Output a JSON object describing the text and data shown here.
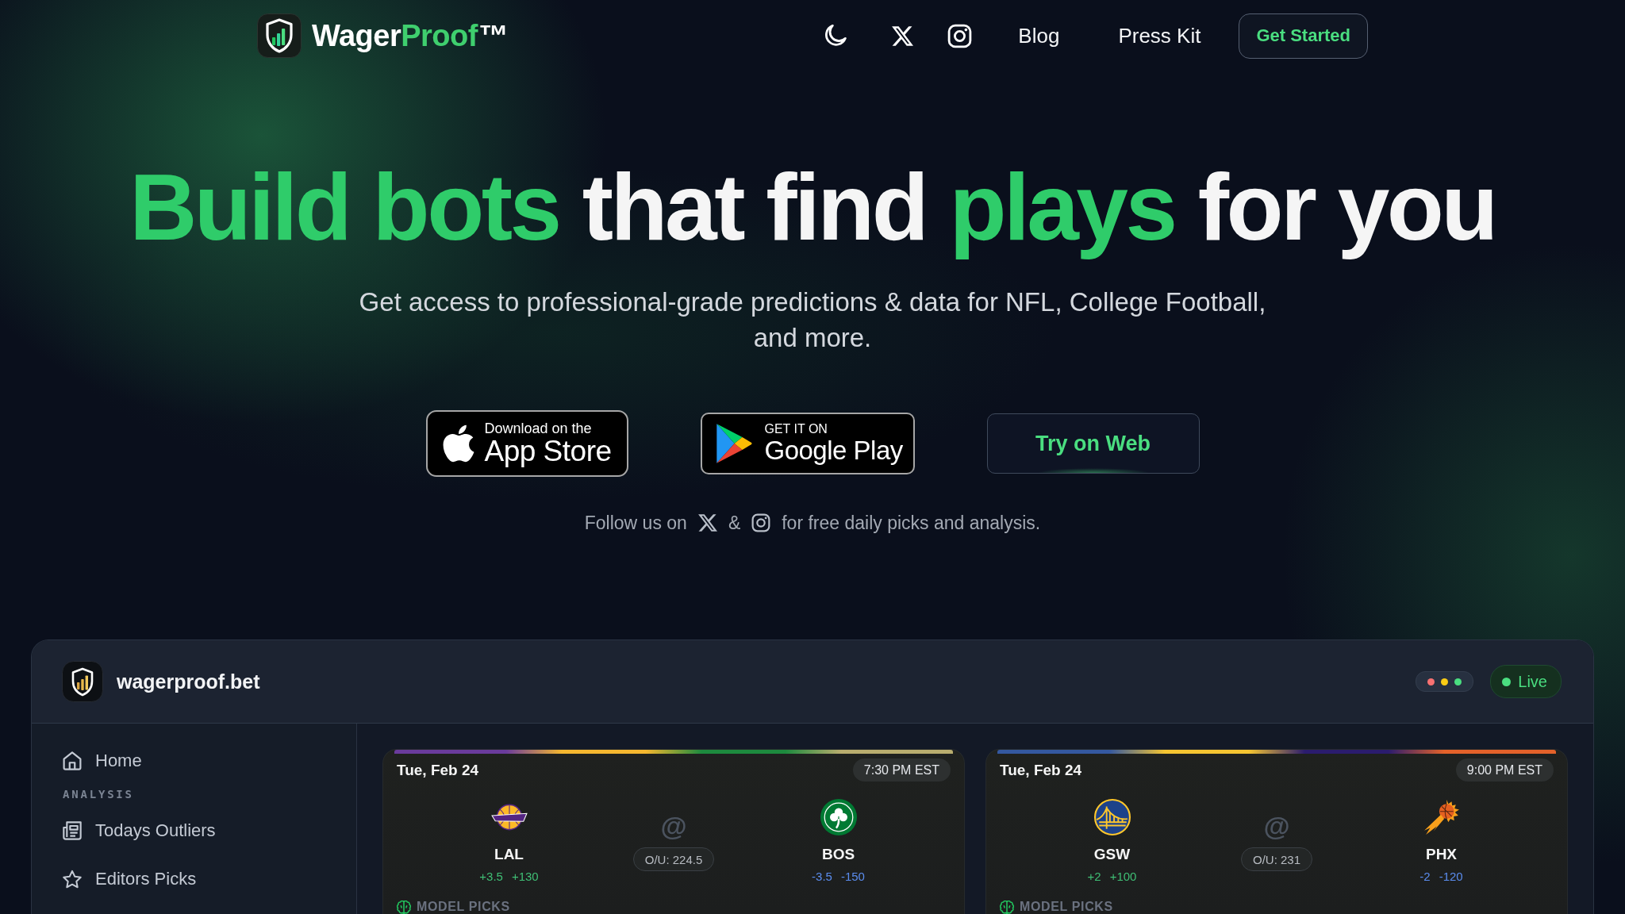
{
  "nav": {
    "logo": {
      "parts": [
        {
          "text": "Wager",
          "accent": false
        },
        {
          "text": "Proof",
          "accent": true
        }
      ],
      "mark": "™"
    },
    "links": [
      {
        "label": "Blog"
      },
      {
        "label": "Press Kit"
      }
    ],
    "cta": "Get Started"
  },
  "hero": {
    "headline": [
      {
        "text": "Build bots ",
        "accent": true
      },
      {
        "text": "that find ",
        "accent": false
      },
      {
        "text": "plays ",
        "accent": true
      },
      {
        "text": "for you",
        "accent": false
      }
    ],
    "subtitle": "Get access to professional-grade predictions & data for NFL, College Football, and more.",
    "app_store": {
      "small": "Download on the",
      "large": "App Store"
    },
    "google_play": {
      "small": "GET IT ON",
      "large": "Google Play"
    },
    "web_button": "Try on Web",
    "follow": {
      "before": "Follow us on",
      "between": "&",
      "after": "for free daily picks and analysis."
    }
  },
  "preview": {
    "site": "wagerproof.bet",
    "window_dots": [
      {
        "color": "#f87171"
      },
      {
        "color": "#facc15"
      },
      {
        "color": "#4ade80"
      }
    ],
    "status": "Live",
    "sidebar": [
      {
        "kind": "link",
        "label": "Home",
        "selected": false
      },
      {
        "kind": "section",
        "label": "ANALYSIS"
      },
      {
        "kind": "link",
        "label": "Todays Outliers",
        "selected": false
      },
      {
        "kind": "link",
        "label": "Editors Picks",
        "selected": false
      }
    ],
    "games": [
      {
        "stripe": [
          {
            "color": "#6a3b9c"
          },
          {
            "color": "#f5b72f"
          },
          {
            "color": "#1d8a3e"
          },
          {
            "color": "#b9ad6e"
          }
        ],
        "date": "Tue, Feb 24",
        "time": "7:30 PM EST",
        "at": "@",
        "total": "O/U: 224.5",
        "away": {
          "abbr": "LAL",
          "spread": "+3.5",
          "moneyline": "+130"
        },
        "home": {
          "abbr": "BOS",
          "spread": "-3.5",
          "moneyline": "-150"
        },
        "picks_label": "MODEL PICKS"
      },
      {
        "stripe": [
          {
            "color": "#3458a0"
          },
          {
            "color": "#f5c531"
          },
          {
            "color": "#2b1c6e"
          },
          {
            "color": "#e4622a"
          }
        ],
        "date": "Tue, Feb 24",
        "time": "9:00 PM EST",
        "at": "@",
        "total": "O/U: 231",
        "away": {
          "abbr": "GSW",
          "spread": "+2",
          "moneyline": "+100"
        },
        "home": {
          "abbr": "PHX",
          "spread": "-2",
          "moneyline": "-120"
        },
        "picks_label": "MODEL PICKS"
      }
    ]
  }
}
